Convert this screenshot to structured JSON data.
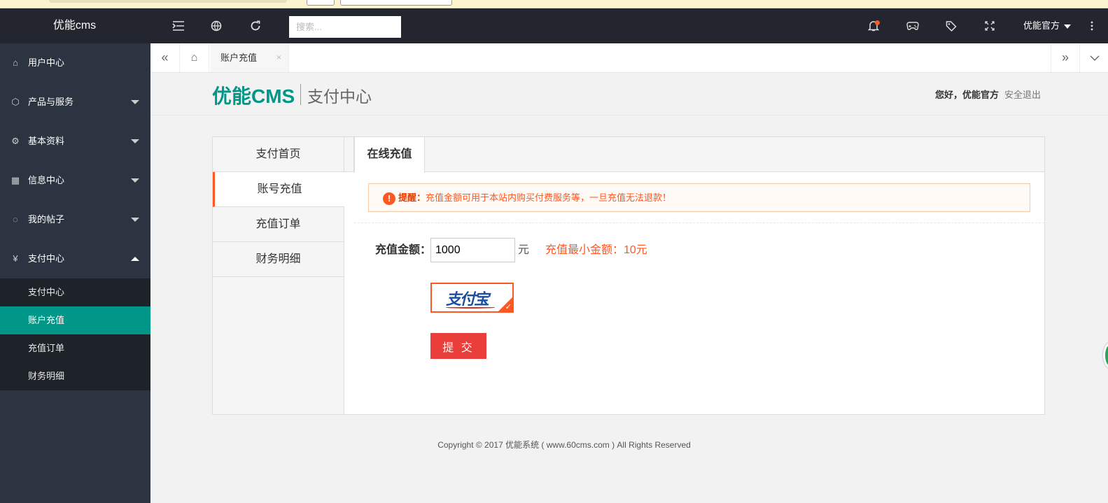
{
  "header": {
    "logo": "优能cms",
    "search_placeholder": "搜索...",
    "user_name": "优能官方",
    "icons": [
      "menu-fold-icon",
      "globe-icon",
      "refresh-icon",
      "bell-icon",
      "gamepad-icon",
      "tag-icon",
      "fullscreen-icon",
      "more-vertical-icon"
    ]
  },
  "sidebar": {
    "items": [
      {
        "label": "用户中心",
        "icon": "home-icon"
      },
      {
        "label": "产品与服务",
        "icon": "box-icon"
      },
      {
        "label": "基本资料",
        "icon": "gear-icon"
      },
      {
        "label": "信息中心",
        "icon": "apps-icon"
      },
      {
        "label": "我的帖子",
        "icon": "chat-icon"
      },
      {
        "label": "支付中心",
        "icon": "yen-icon"
      }
    ],
    "sub_items": [
      {
        "label": "支付中心"
      },
      {
        "label": "账户充值"
      },
      {
        "label": "充值订单"
      },
      {
        "label": "财务明细"
      }
    ]
  },
  "tabbar": {
    "active_tab": "账户充值",
    "close_symbol": "×"
  },
  "pay": {
    "brand": "优能CMS",
    "brand_sub": "支付中心",
    "greeting": "您好，优能官方",
    "logout": "安全退出",
    "left_menu": [
      "支付首页",
      "账号充值",
      "充值订单",
      "财务明细"
    ],
    "tab": "在线充值",
    "notice_title": "提醒：",
    "notice_text": "充值金额可用于本站内购买付费服务等，一旦充值无法退款！",
    "amount_label": "充值金额：",
    "amount_value": "1000",
    "unit": "元",
    "min_amount": "充值最小金额：10元",
    "alipay_text": "支付宝",
    "submit": "提 交"
  },
  "footer": {
    "copyright": "Copyright © 2017 优能系统 ( www.60cms.com )  All Rights Reserved"
  },
  "colors": {
    "header_bg": "#23262e",
    "sidebar_bg": "#2b3440",
    "accent_green": "#009688",
    "accent_orange": "#ff5722",
    "submit_red": "#ea3e3a"
  }
}
